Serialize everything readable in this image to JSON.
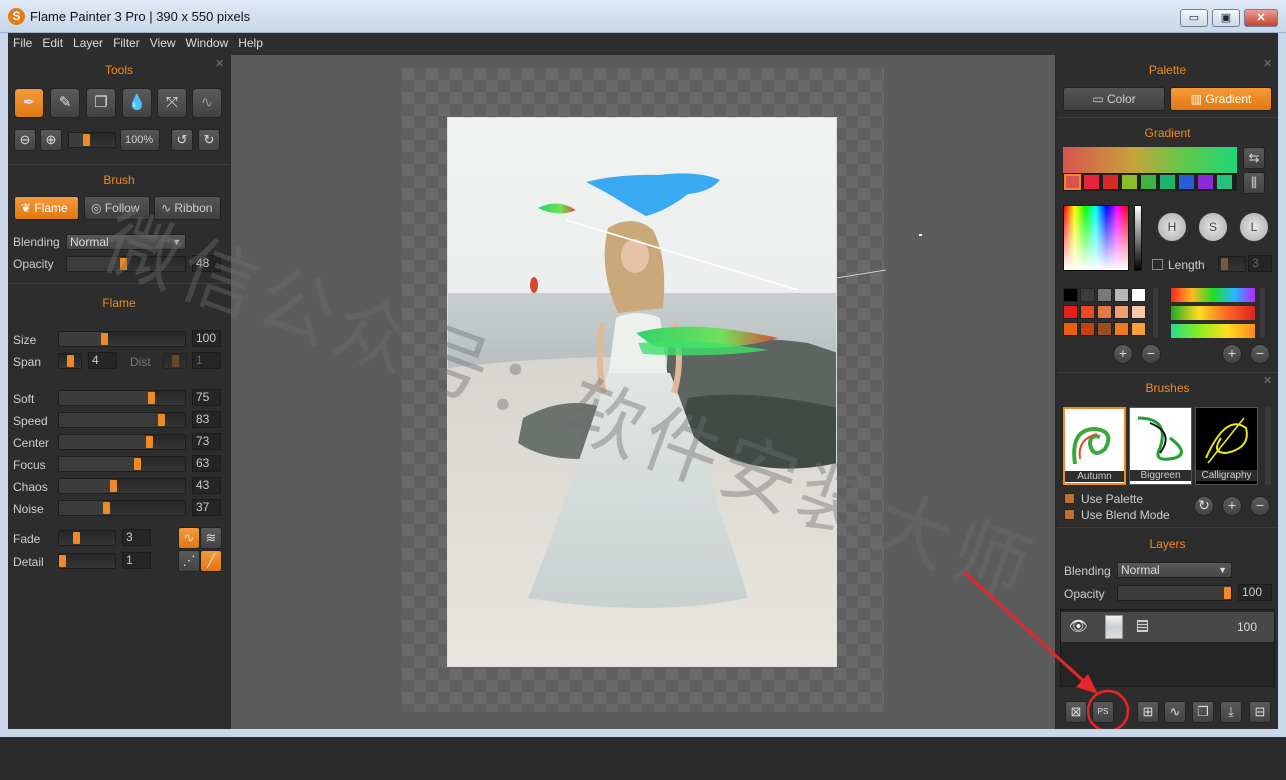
{
  "window": {
    "title": "Flame Painter 3 Pro | 390 x 550 pixels",
    "logo_letter": "S",
    "minimize": "▭",
    "maximize": "▣",
    "close": "✕"
  },
  "menu": [
    "File",
    "Edit",
    "Layer",
    "Filter",
    "View",
    "Window",
    "Help"
  ],
  "tools": {
    "title": "Tools",
    "icons": [
      "flame-brush-icon",
      "pencil-icon",
      "eraser-icon",
      "blur-drop-icon",
      "transform-arrows-icon",
      "smudge-wave-icon"
    ],
    "zoom": "100%",
    "zoom_level": 0.35
  },
  "brush": {
    "title": "Brush",
    "modes": [
      "Flame",
      "Follow",
      "Ribbon"
    ],
    "active_mode": "Flame",
    "blending_label": "Blending",
    "blending_value": "Normal",
    "opacity_label": "Opacity",
    "opacity_value": "48"
  },
  "flame": {
    "title": "Flame",
    "size": {
      "label": "Size",
      "value": "100"
    },
    "span": {
      "label": "Span",
      "value": "4"
    },
    "dist": {
      "label": "Dist",
      "value": "1"
    },
    "params": [
      {
        "label": "Soft",
        "value": "75"
      },
      {
        "label": "Speed",
        "value": "83"
      },
      {
        "label": "Center",
        "value": "73"
      },
      {
        "label": "Focus",
        "value": "63"
      },
      {
        "label": "Chaos",
        "value": "43"
      },
      {
        "label": "Noise",
        "value": "37"
      }
    ],
    "fade": {
      "label": "Fade",
      "value": "3"
    },
    "detail": {
      "label": "Detail",
      "value": "1"
    }
  },
  "palette": {
    "title": "Palette",
    "tab_color": "Color",
    "tab_gradient": "Gradient",
    "gradient_title": "Gradient",
    "gradient_swatches": [
      "#d9534f",
      "#e8243c",
      "#d42a2a",
      "#8bbd2a",
      "#3fb33f",
      "#1eb36a",
      "#2a5cd4",
      "#8a2ad4",
      "#25c07a"
    ],
    "hsl": [
      "H",
      "S",
      "L"
    ],
    "length_label": "Length",
    "length_value": "3",
    "swatches": [
      "#000000",
      "#3c3c3c",
      "#7a7a7a",
      "#b8b8b8",
      "#ffffff",
      "#e81c1c",
      "#e84a2a",
      "#e87848",
      "#f0a070",
      "#f8c8a8",
      "#e86010",
      "#c84010",
      "#985020",
      "#f07820",
      "#f8a038"
    ]
  },
  "brushes": {
    "title": "Brushes",
    "items": [
      "Autumn",
      "Biggreen",
      "Calligraphy"
    ],
    "use_palette": "Use Palette",
    "use_blend_mode": "Use Blend Mode"
  },
  "layers": {
    "title": "Layers",
    "blending_label": "Blending",
    "blending_value": "Normal",
    "opacity_label": "Opacity",
    "opacity_value": "100",
    "layer_opacity": "100",
    "psd_label": "PS"
  },
  "watermark": "微信公众号：软件安装大师",
  "colors": {
    "accent": "#f08a24",
    "panel": "#2d2d2d",
    "canvas": "#5c5c5c"
  }
}
